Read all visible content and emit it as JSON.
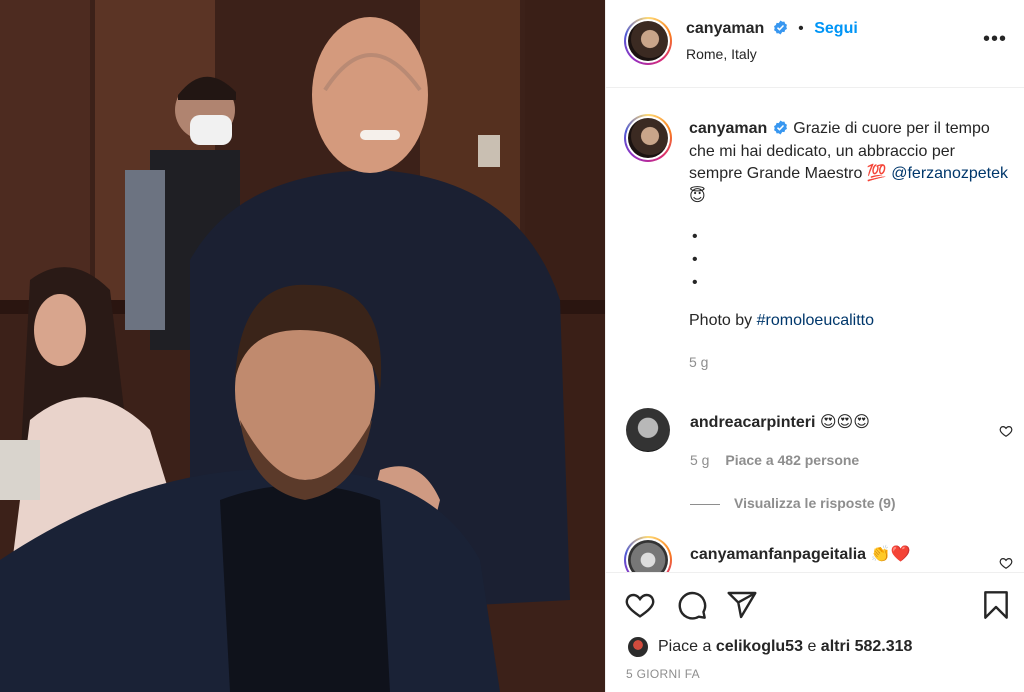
{
  "post": {
    "author": "canyaman",
    "follow_label": "Segui",
    "separator": "•",
    "location": "Rome, Italy",
    "more_label": "•••"
  },
  "caption": {
    "username": "canyaman",
    "text": "Grazie di cuore per il tempo che mi hai dedicato, un abbraccio per sempre Grande Maestro",
    "emoji_hundred": "💯",
    "mention": "@ferzanozpetek",
    "emoji_angel": "😇",
    "bullets": [
      "•",
      "•",
      "•"
    ],
    "photo_by_prefix": "Photo by",
    "hashtag": "#romoloeucalitto",
    "time": "5 g"
  },
  "comments": [
    {
      "username": "andreacarpinteri",
      "text": "😍😍😍",
      "time": "5 g",
      "likes": "Piace a 482 persone",
      "replies": "Visualizza le risposte (9)"
    },
    {
      "username": "canyamanfanpageitalia",
      "text": "👏❤️"
    }
  ],
  "likes": {
    "prefix": "Piace a",
    "user": "celikoglu53",
    "suffix": "e",
    "others": "altri 582.318"
  },
  "posted": "5 GIORNI FA",
  "icons": {
    "like": "heart-icon",
    "comment": "comment-icon",
    "share": "share-icon",
    "save": "bookmark-icon",
    "verified": "verified-badge-icon"
  },
  "colors": {
    "accent": "#0095f6",
    "link": "#00376b",
    "muted": "#8e8e8e",
    "verified": "#3897f0"
  }
}
